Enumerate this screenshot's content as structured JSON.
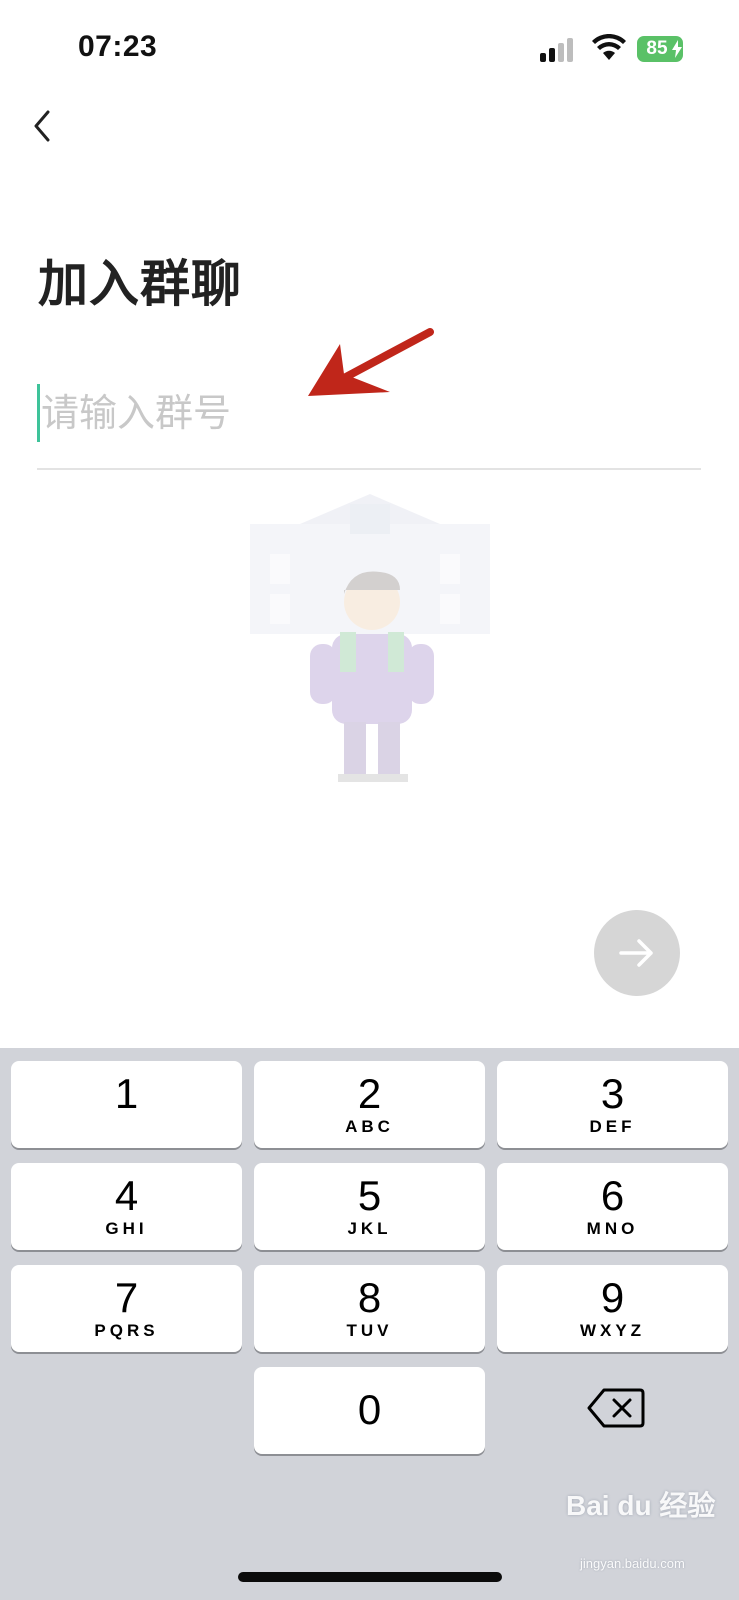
{
  "status_bar": {
    "time": "07:23",
    "battery_level": "85",
    "signal_icon": "signal-bars-icon",
    "wifi_icon": "wifi-icon",
    "battery_icon": "battery-charging-icon",
    "battery_color": "#5ac167"
  },
  "nav": {
    "back_icon": "chevron-left-icon"
  },
  "page": {
    "title": "加入群聊",
    "input_placeholder": "请输入群号",
    "input_value": "",
    "illustration": "student-school-illustration",
    "next_icon": "arrow-right-icon"
  },
  "annotation": {
    "arrow_color": "#c0261a"
  },
  "keyboard": {
    "keys": [
      {
        "num": "1",
        "letters": ""
      },
      {
        "num": "2",
        "letters": "ABC"
      },
      {
        "num": "3",
        "letters": "DEF"
      },
      {
        "num": "4",
        "letters": "GHI"
      },
      {
        "num": "5",
        "letters": "JKL"
      },
      {
        "num": "6",
        "letters": "MNO"
      },
      {
        "num": "7",
        "letters": "PQRS"
      },
      {
        "num": "8",
        "letters": "TUV"
      },
      {
        "num": "9",
        "letters": "WXYZ"
      },
      {
        "num": "0",
        "letters": ""
      }
    ],
    "delete_icon": "backspace-icon"
  },
  "watermark": {
    "brand": "Bai du 经验",
    "site": "jingyan.baidu.com"
  }
}
